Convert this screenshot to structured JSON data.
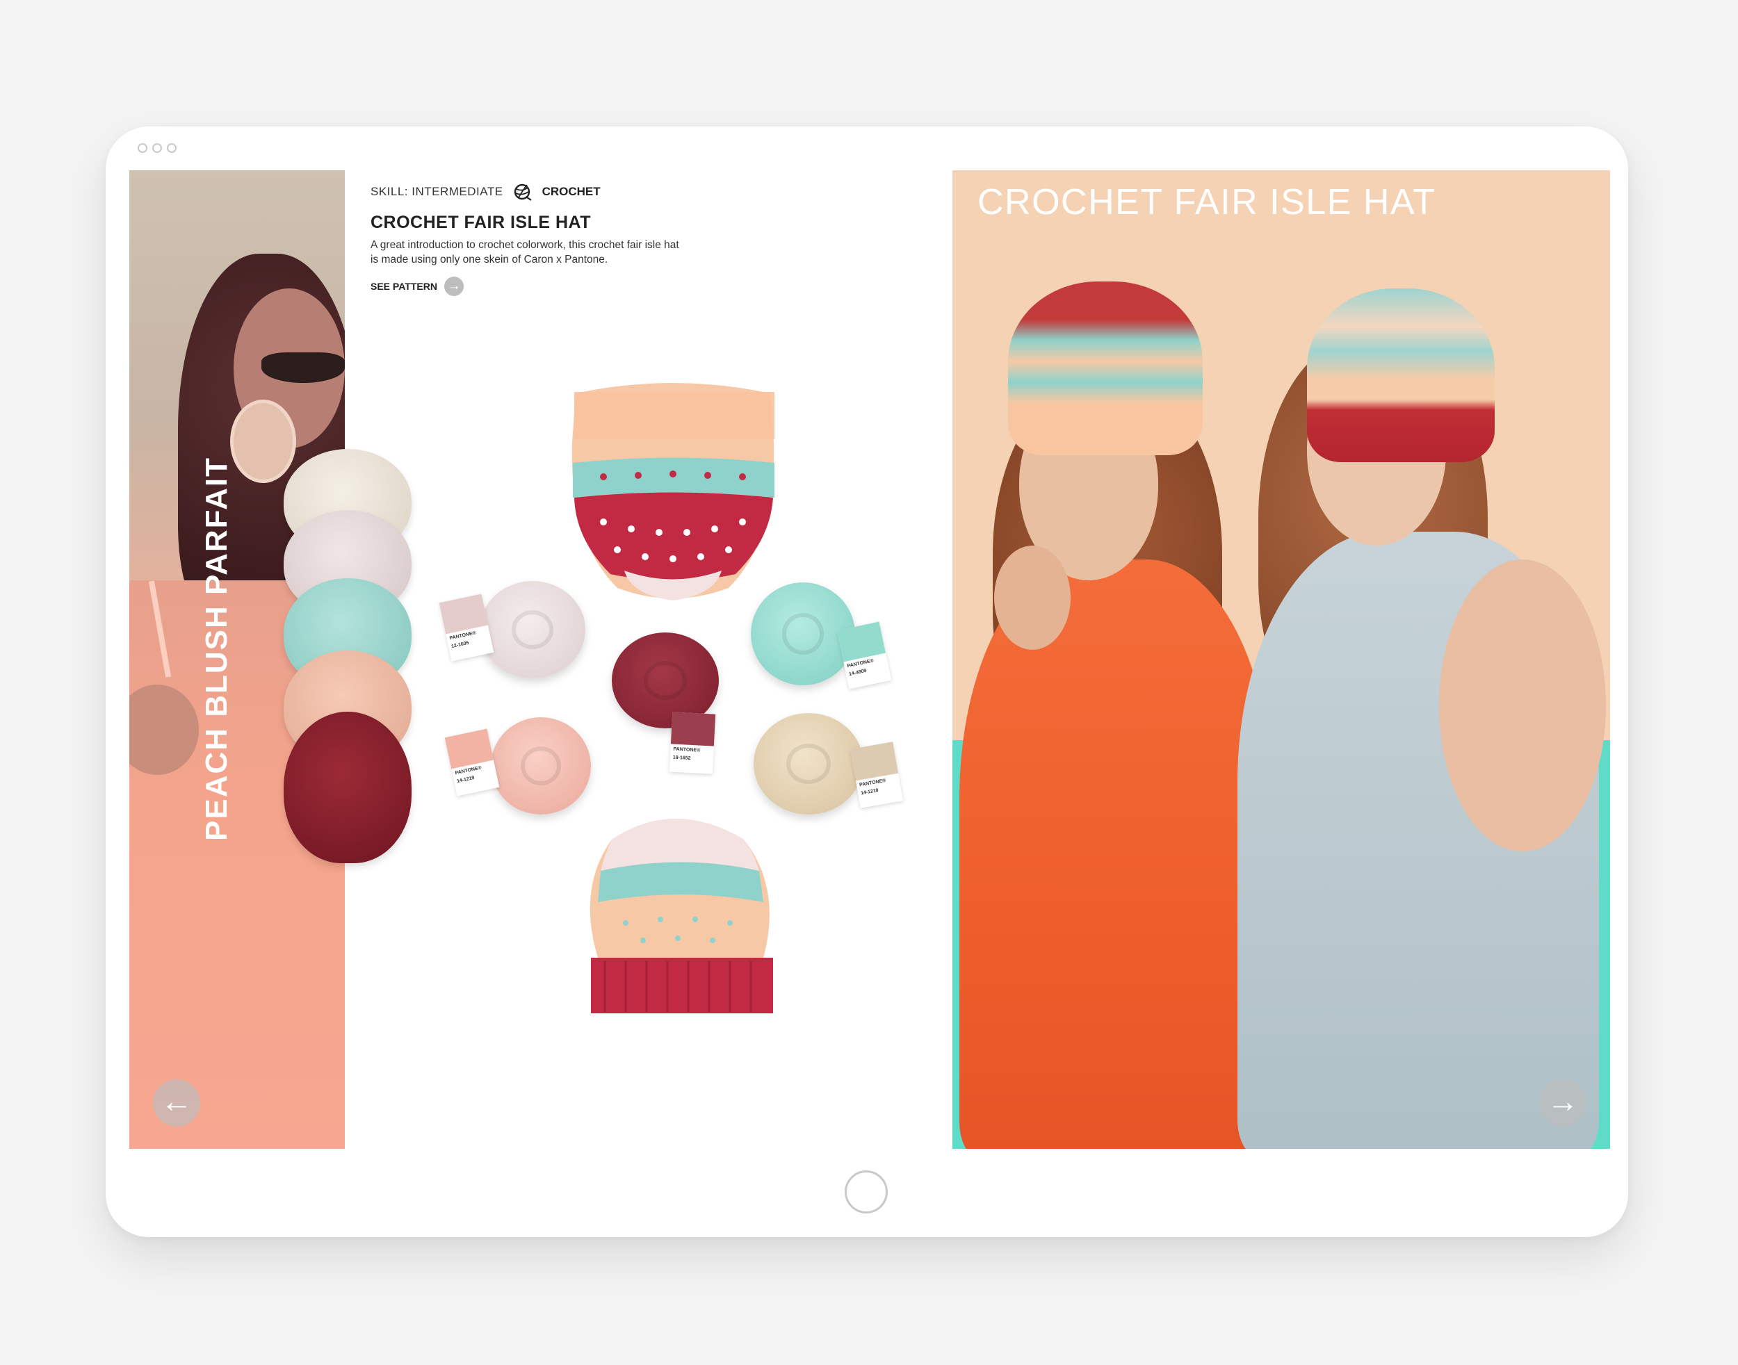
{
  "window": {
    "controls": [
      "dot",
      "dot",
      "dot"
    ]
  },
  "left_panel": {
    "vertical_title": "PEACH BLUSH PARFAIT",
    "prev_arrow": "←"
  },
  "pattern": {
    "skill_label": "SKILL: INTERMEDIATE",
    "craft_icon": "yarn-ball-icon",
    "craft_label": "CROCHET",
    "title": "CROCHET FAIR ISLE HAT",
    "description": "A great introduction to crochet colorwork, this crochet fair isle hat is made using only one skein of Caron x Pantone.",
    "see_pattern_label": "SEE PATTERN",
    "see_pattern_arrow": "→"
  },
  "flat_lay": {
    "swatches": [
      {
        "brand": "PANTONE®",
        "code": "12-1605",
        "color": "#e3ccc9"
      },
      {
        "brand": "PANTONE®",
        "code": "14-1219",
        "color": "#f2b3a5"
      },
      {
        "brand": "PANTONE®",
        "code": "18-1652",
        "color": "#9b3e4e"
      },
      {
        "brand": "PANTONE®",
        "code": "14-4809",
        "color": "#93dccd"
      },
      {
        "brand": "PANTONE®",
        "code": "14-1210",
        "color": "#dccbb0"
      }
    ]
  },
  "right_panel": {
    "title": "CROCHET FAIR ISLE HAT",
    "next_arrow": "→"
  },
  "colors": {
    "peach": "#f7c8a6",
    "teal": "#8fd2cb",
    "cranberry": "#c22a43",
    "burgundy": "#8e2030",
    "cream": "#f2ece2"
  }
}
